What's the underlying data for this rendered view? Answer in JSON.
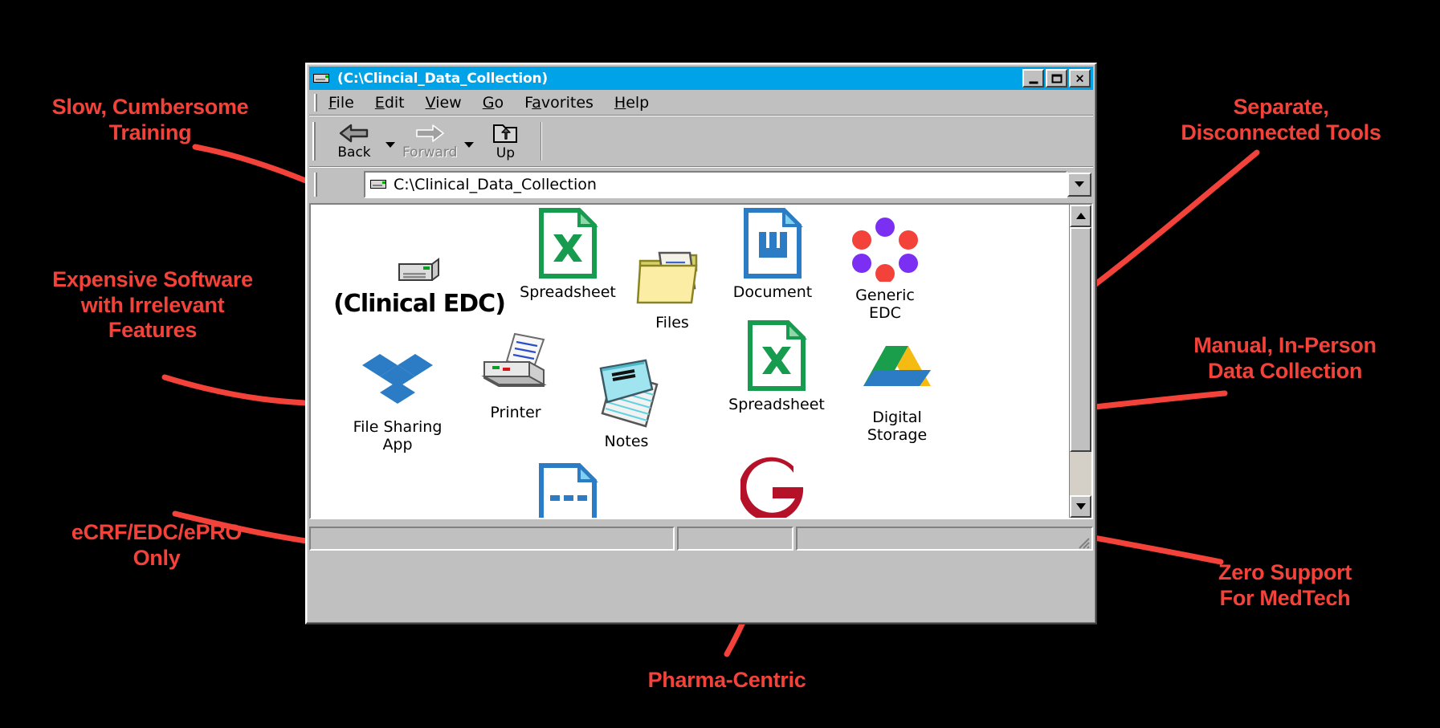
{
  "window": {
    "title": "(C:\\Clincial_Data_Collection)",
    "title_icon": "drive-icon",
    "controls": {
      "minimize": "_",
      "maximize": "□",
      "close": "×"
    },
    "menu": [
      {
        "label": "File",
        "accel": "F"
      },
      {
        "label": "Edit",
        "accel": "E"
      },
      {
        "label": "View",
        "accel": "V"
      },
      {
        "label": "Go",
        "accel": "G"
      },
      {
        "label": "Favorites",
        "accel": "a"
      },
      {
        "label": "Help",
        "accel": "H"
      }
    ],
    "toolbar": [
      {
        "label": "Back",
        "icon": "back-arrow-icon",
        "enabled": true,
        "has_dropdown": true
      },
      {
        "label": "Forward",
        "icon": "forward-arrow-icon",
        "enabled": false,
        "has_dropdown": true
      },
      {
        "label": "Up",
        "icon": "up-folder-icon",
        "enabled": true,
        "has_dropdown": false
      }
    ],
    "address": {
      "value": "C:\\Clinical_Data_Collection",
      "icon": "drive-icon",
      "dropdown_icon": "chevron-down-icon"
    },
    "statusbar": {
      "panel1": "",
      "panel2": "",
      "panel3": ""
    },
    "scrollbar": {
      "up_icon": "triangle-up-icon",
      "down_icon": "triangle-down-icon"
    }
  },
  "icons": [
    {
      "label": "(Clinical EDC)",
      "icon": "drive-icon",
      "style": "big"
    },
    {
      "label": "Spreadsheet",
      "icon": "excel-spreadsheet-icon"
    },
    {
      "label": "Files",
      "icon": "folder-with-documents-icon"
    },
    {
      "label": "Document",
      "icon": "word-document-icon"
    },
    {
      "label": "Generic\nEDC",
      "icon": "dot-ring-icon"
    },
    {
      "label": "File Sharing\nApp",
      "icon": "dropbox-icon"
    },
    {
      "label": "Printer",
      "icon": "printer-icon"
    },
    {
      "label": "Notes",
      "icon": "notepad-icon"
    },
    {
      "label": "Spreadsheet",
      "icon": "excel-spreadsheet-icon"
    },
    {
      "label": "Digital\nStorage",
      "icon": "google-drive-icon"
    },
    {
      "label": "",
      "icon": "blue-document-icon"
    },
    {
      "label": "",
      "icon": "google-g-icon"
    }
  ],
  "annotations": [
    {
      "id": "slow-training",
      "text": "Slow, Cumbersome\nTraining"
    },
    {
      "id": "expensive-software",
      "text": "Expensive Software\nwith Irrelevant\nFeatures"
    },
    {
      "id": "ecrf-only",
      "text": "eCRF/EDC/ePRO\nOnly"
    },
    {
      "id": "pharma-centric",
      "text": "Pharma-Centric"
    },
    {
      "id": "separate-tools",
      "text": "Separate,\nDisconnected Tools"
    },
    {
      "id": "manual-collection",
      "text": "Manual, In-Person\nData Collection"
    },
    {
      "id": "zero-support",
      "text": "Zero Support\nFor MedTech"
    }
  ],
  "colors": {
    "annotation": "#f2423a",
    "titlebar": "#00a2e8",
    "window_face": "#c0c0c0",
    "background": "#000000",
    "excel_green": "#169b4f",
    "word_blue": "#2b7cc4",
    "edc_red": "#f2423a",
    "edc_purple": "#7b2ff2"
  }
}
